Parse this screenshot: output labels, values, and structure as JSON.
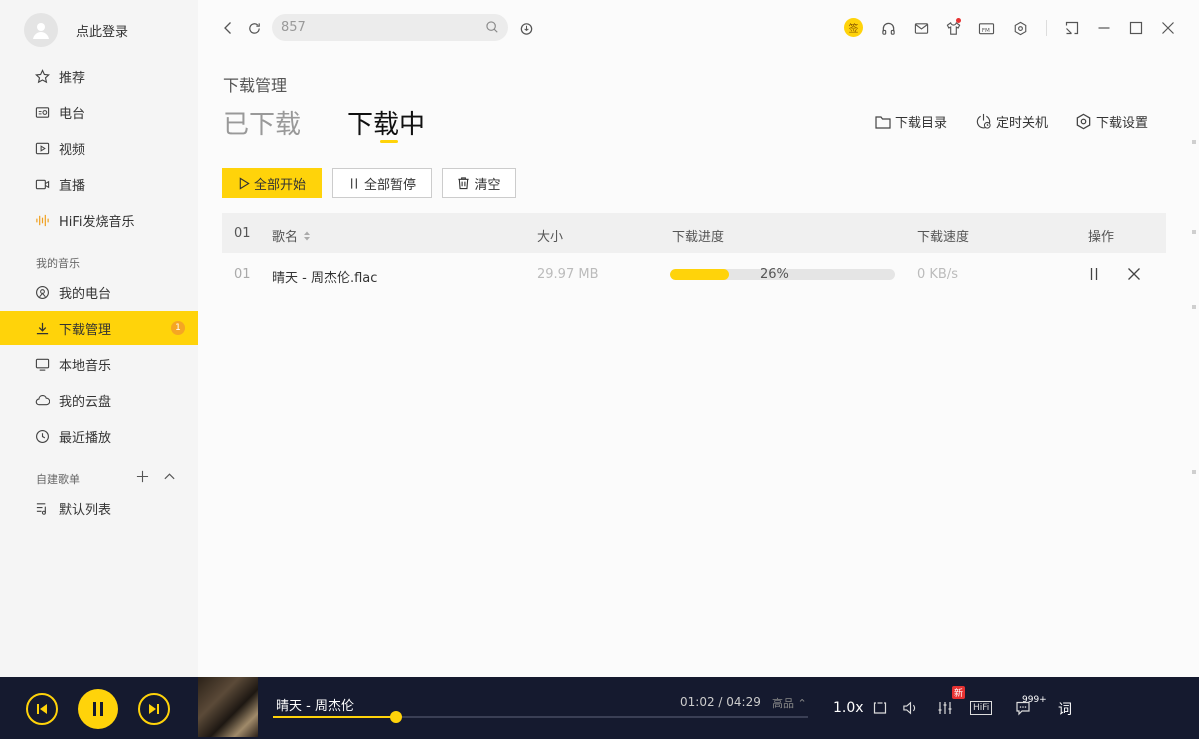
{
  "sidebar": {
    "login_text": "点此登录",
    "items": [
      {
        "label": "推荐",
        "icon": "star-icon"
      },
      {
        "label": "电台",
        "icon": "radio-icon"
      },
      {
        "label": "视频",
        "icon": "video-icon"
      },
      {
        "label": "直播",
        "icon": "live-icon"
      },
      {
        "label": "HiFi发烧音乐",
        "icon": "hifi-wave-icon"
      }
    ],
    "my_music_label": "我的音乐",
    "my_items": [
      {
        "label": "我的电台",
        "icon": "my-radio-icon"
      },
      {
        "label": "下载管理",
        "icon": "download-icon",
        "badge": "1"
      },
      {
        "label": "本地音乐",
        "icon": "monitor-icon"
      },
      {
        "label": "我的云盘",
        "icon": "cloud-icon"
      },
      {
        "label": "最近播放",
        "icon": "clock-icon"
      }
    ],
    "playlist_label": "自建歌单",
    "playlist_items": [
      {
        "label": "默认列表",
        "icon": "playlist-icon"
      }
    ]
  },
  "topbar": {
    "search_value": "857",
    "sign_label": "签"
  },
  "main": {
    "page_title": "下载管理",
    "tabs": [
      "已下载",
      "下载中"
    ],
    "actions": [
      {
        "label": "下载目录",
        "icon": "folder-icon"
      },
      {
        "label": "定时关机",
        "icon": "timer-icon"
      },
      {
        "label": "下载设置",
        "icon": "settings-hex-icon"
      }
    ],
    "buttons": {
      "start_all": "全部开始",
      "pause_all": "全部暂停",
      "clear": "清空"
    },
    "table": {
      "headers": [
        "01",
        "歌名",
        "大小",
        "下载进度",
        "下载速度",
        "操作"
      ],
      "rows": [
        {
          "index": "01",
          "name": "晴天 - 周杰伦.flac",
          "size": "29.97 MB",
          "progress": 26,
          "progress_text": "26%",
          "speed": "0 KB/s"
        }
      ]
    }
  },
  "player": {
    "song": "晴天 - 周杰伦",
    "time": "01:02 / 04:29",
    "quality": "高品",
    "progress_fraction": 0.23,
    "speed": "1.0x",
    "new_tag": "新",
    "hifi_label": "HiFi",
    "comment_count": "999+",
    "lyric_label": "词"
  },
  "colors": {
    "accent": "#ffd30a",
    "player_bg": "#151a2f",
    "sidebar_bg": "#f5f5f5"
  }
}
